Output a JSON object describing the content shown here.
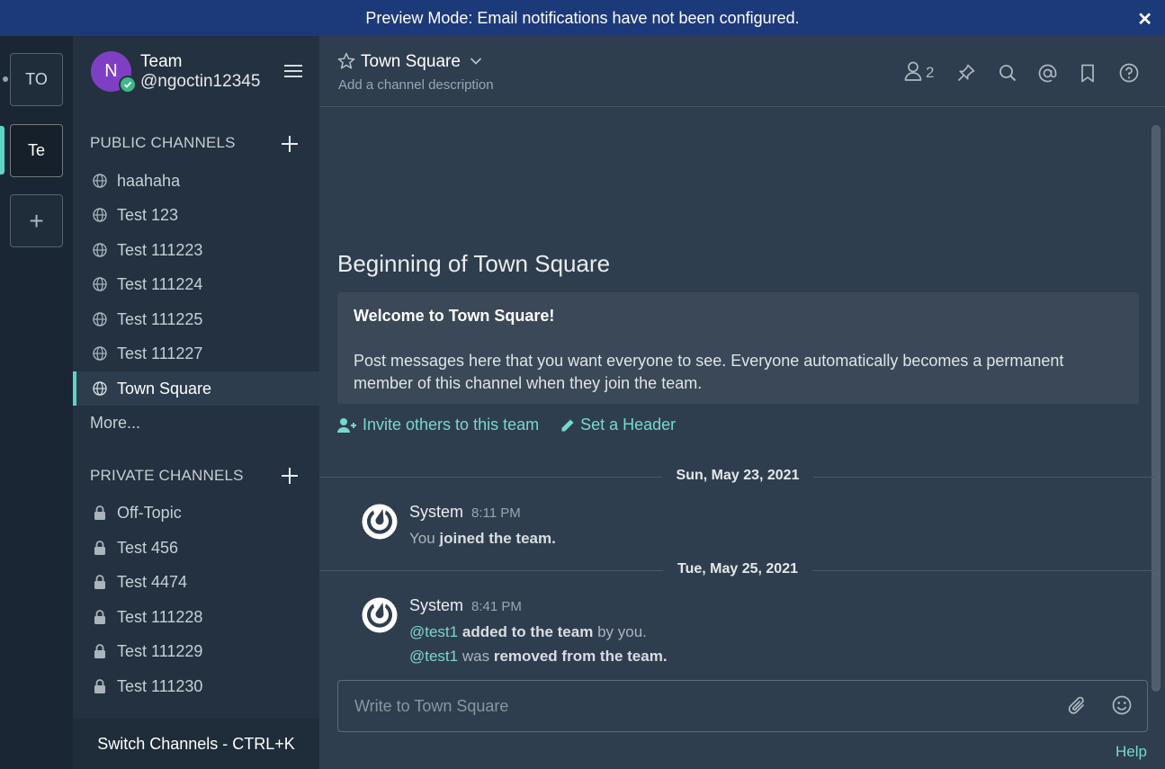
{
  "banner": {
    "text": "Preview Mode: Email notifications have not been configured.",
    "close_icon": "close-icon"
  },
  "teams": [
    {
      "label": "TO"
    },
    {
      "label": "Te"
    },
    {
      "label": "+"
    }
  ],
  "sidebar": {
    "team_name": "Team",
    "user_name": "@ngoctin12345",
    "avatar_initial": "N",
    "public_title": "PUBLIC CHANNELS",
    "public_channels": [
      {
        "label": "haahaha"
      },
      {
        "label": "Test 123"
      },
      {
        "label": "Test 111223"
      },
      {
        "label": "Test 111224"
      },
      {
        "label": "Test 111225"
      },
      {
        "label": "Test 111227"
      },
      {
        "label": "Town Square"
      }
    ],
    "more_label": "More...",
    "private_title": "PRIVATE CHANNELS",
    "private_channels": [
      {
        "label": "Off-Topic"
      },
      {
        "label": "Test 456"
      },
      {
        "label": "Test 4474"
      },
      {
        "label": "Test 111228"
      },
      {
        "label": "Test 111229"
      },
      {
        "label": "Test 111230"
      }
    ],
    "switch_label": "Switch Channels - CTRL+K"
  },
  "header": {
    "channel_name": "Town Square",
    "description": "Add a channel description",
    "member_count": "2"
  },
  "intro": {
    "title": "Beginning of Town Square",
    "welcome": "Welcome to Town Square!",
    "body": "Post messages here that you want everyone to see. Everyone automatically becomes a permanent member of this channel when they join the team.",
    "invite_label": "Invite others to this team",
    "header_label": "Set a Header"
  },
  "posts": {
    "date1": "Sun, May 23, 2021",
    "p1_user": "System",
    "p1_time": "8:11 PM",
    "p1_text_a": "You",
    "p1_text_b": "joined the team.",
    "date2": "Tue, May 25, 2021",
    "p2_user": "System",
    "p2_time": "8:41 PM",
    "p2_mention1": "@test1",
    "p2_text1_b": "added to the team",
    "p2_text1_c": "by you.",
    "p2_mention2": "@test1",
    "p2_text2_a": "was",
    "p2_text2_b": "removed from the team."
  },
  "composer": {
    "placeholder": "Write to Town Square"
  },
  "help_label": "Help",
  "colors": {
    "accent": "#5dd5c5",
    "banner": "#1c3a7a",
    "link": "#77d8d0"
  }
}
